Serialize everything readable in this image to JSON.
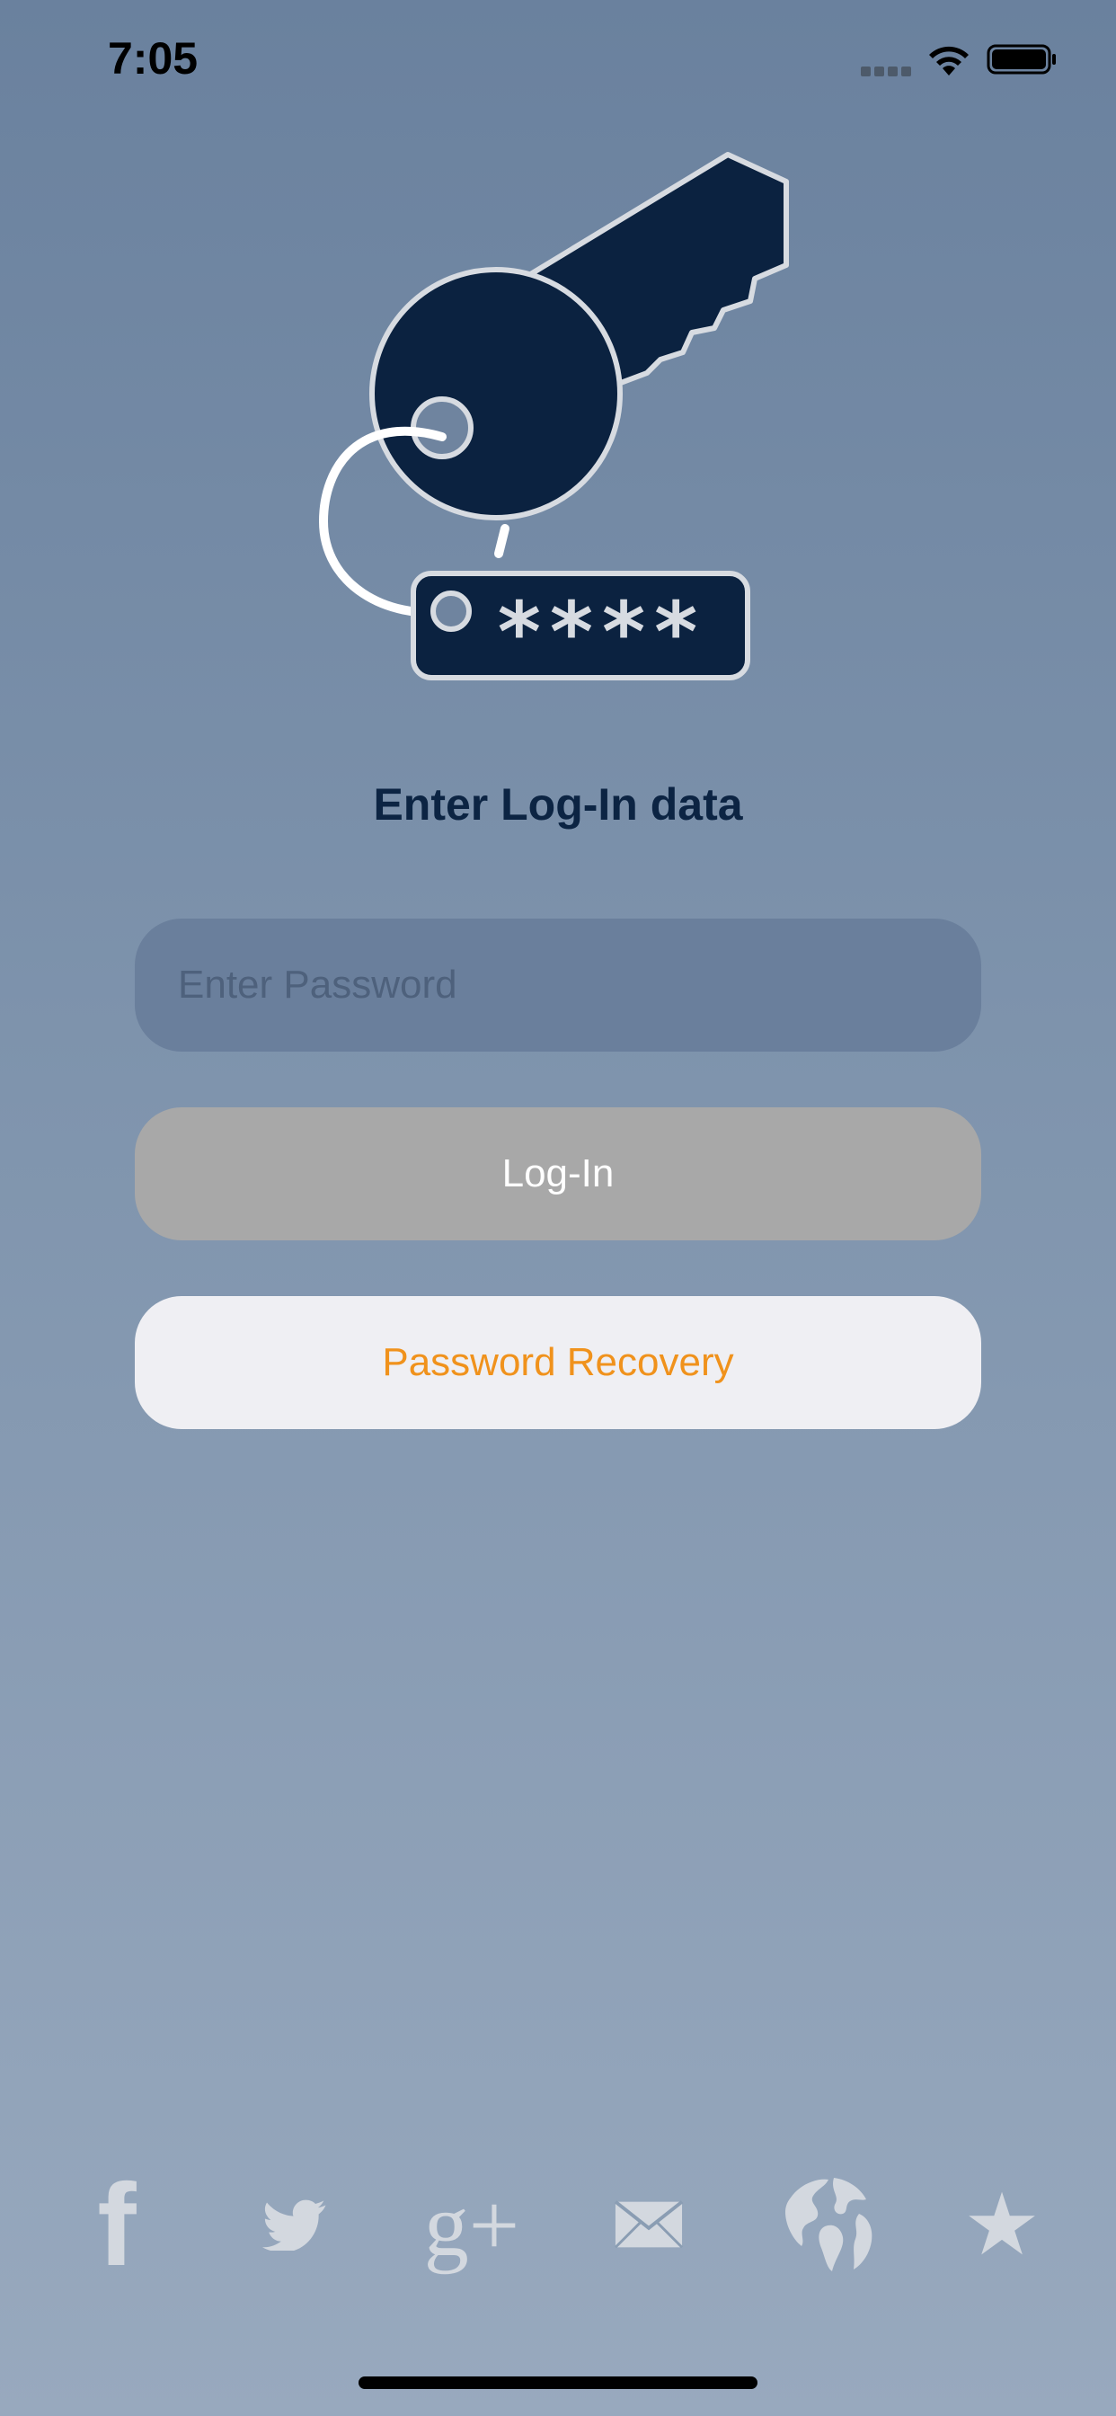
{
  "status_bar": {
    "time": "7:05"
  },
  "login": {
    "title": "Enter Log-In data",
    "password_placeholder": "Enter Password",
    "login_label": "Log-In",
    "recovery_label": "Password Recovery"
  },
  "logo": {
    "tag_text": "****"
  },
  "social": {
    "facebook_glyph": "f",
    "google_plus_glyph": "g+",
    "star_glyph": "★",
    "icons": [
      "facebook-icon",
      "twitter-icon",
      "google-plus-icon",
      "mail-icon",
      "globe-icon",
      "star-icon"
    ]
  },
  "colors": {
    "background_top": "#6a819e",
    "background_bottom": "#98a9be",
    "title": "#0c2443",
    "login_button": "#a8a8a8",
    "recovery_button": "#efeff3",
    "recovery_text": "#f0921c",
    "logo_dark": "#0b2240"
  }
}
